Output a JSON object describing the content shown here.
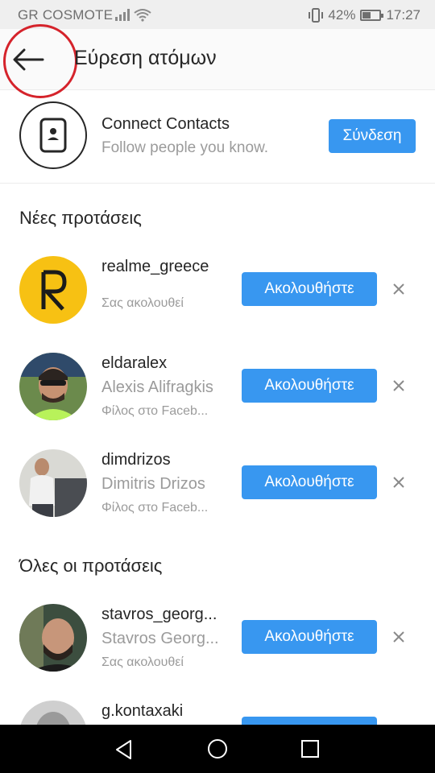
{
  "status_bar": {
    "carrier": "GR COSMOTE",
    "battery_percent": "42%",
    "time": "17:27"
  },
  "header": {
    "title": "Εύρεση ατόμων"
  },
  "connect": {
    "title": "Connect Contacts",
    "subtitle": "Follow people you know.",
    "button": "Σύνδεση"
  },
  "sections": {
    "new": "Νέες προτάσεις",
    "all": "Όλες οι προτάσεις"
  },
  "suggestions": [
    {
      "username": "realme_greece",
      "full_name": "",
      "sub": "Σας ακολουθεί",
      "button": "Ακολουθήστε"
    },
    {
      "username": "eldaralex",
      "full_name": "Alexis Alifragkis",
      "sub": "Φίλος στο Faceb...",
      "button": "Ακολουθήστε"
    },
    {
      "username": "dimdrizos",
      "full_name": "Dimitris Drizos",
      "sub": "Φίλος στο Faceb...",
      "button": "Ακολουθήστε"
    },
    {
      "username": "stavros_georg...",
      "full_name": "Stavros Georg...",
      "sub": "Σας ακολουθεί",
      "button": "Ακολουθήστε"
    },
    {
      "username": "g.kontaxaki",
      "full_name": "",
      "sub": "",
      "button": ""
    }
  ],
  "colors": {
    "accent": "#3897f0",
    "annotation_circle": "#d5232b"
  }
}
